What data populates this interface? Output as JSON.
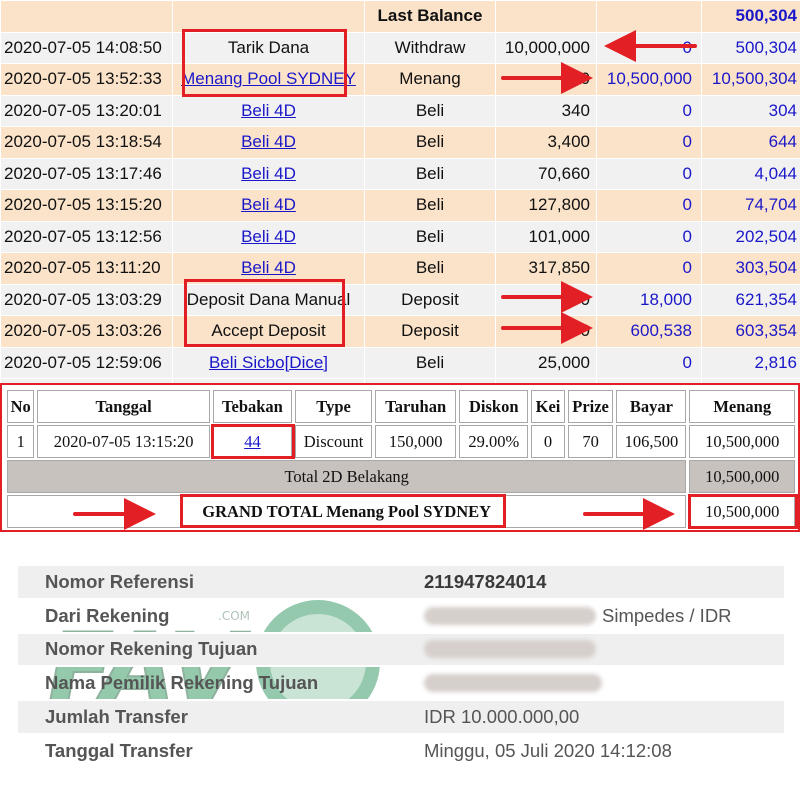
{
  "ledger": {
    "header": {
      "label": "Last Balance",
      "balance": "500,304"
    },
    "rows": [
      {
        "date": "2020-07-05 14:08:50",
        "desc": "Tarik Dana",
        "link": false,
        "type": "Withdraw",
        "debit": "10,000,000",
        "credit": "0",
        "balance": "500,304"
      },
      {
        "date": "2020-07-05 13:52:33",
        "desc": "Menang Pool SYDNEY",
        "link": true,
        "type": "Menang",
        "debit": "0",
        "credit": "10,500,000",
        "balance": "10,500,304"
      },
      {
        "date": "2020-07-05 13:20:01",
        "desc": "Beli 4D",
        "link": true,
        "type": "Beli",
        "debit": "340",
        "credit": "0",
        "balance": "304"
      },
      {
        "date": "2020-07-05 13:18:54",
        "desc": "Beli 4D",
        "link": true,
        "type": "Beli",
        "debit": "3,400",
        "credit": "0",
        "balance": "644"
      },
      {
        "date": "2020-07-05 13:17:46",
        "desc": "Beli 4D",
        "link": true,
        "type": "Beli",
        "debit": "70,660",
        "credit": "0",
        "balance": "4,044"
      },
      {
        "date": "2020-07-05 13:15:20",
        "desc": "Beli 4D",
        "link": true,
        "type": "Beli",
        "debit": "127,800",
        "credit": "0",
        "balance": "74,704"
      },
      {
        "date": "2020-07-05 13:12:56",
        "desc": "Beli 4D",
        "link": true,
        "type": "Beli",
        "debit": "101,000",
        "credit": "0",
        "balance": "202,504"
      },
      {
        "date": "2020-07-05 13:11:20",
        "desc": "Beli 4D",
        "link": true,
        "type": "Beli",
        "debit": "317,850",
        "credit": "0",
        "balance": "303,504"
      },
      {
        "date": "2020-07-05 13:03:29",
        "desc": "Deposit Dana Manual",
        "link": false,
        "type": "Deposit",
        "debit": "0",
        "credit": "18,000",
        "balance": "621,354"
      },
      {
        "date": "2020-07-05 13:03:26",
        "desc": "Accept Deposit",
        "link": false,
        "type": "Deposit",
        "debit": "0",
        "credit": "600,538",
        "balance": "603,354"
      },
      {
        "date": "2020-07-05 12:59:06",
        "desc": "Beli Sicbo[Dice]",
        "link": true,
        "type": "Beli",
        "debit": "25,000",
        "credit": "0",
        "balance": "2,816"
      }
    ]
  },
  "bet": {
    "headers": [
      "No",
      "Tanggal",
      "Tebakan",
      "Type",
      "Taruhan",
      "Diskon",
      "Kei",
      "Prize",
      "Bayar",
      "Menang"
    ],
    "row": {
      "no": "1",
      "tanggal": "2020-07-05 13:15:20",
      "tebakan": "44",
      "type": "Discount",
      "taruhan": "150,000",
      "diskon": "29.00%",
      "kei": "0",
      "prize": "70",
      "bayar": "106,500",
      "menang": "10,500,000"
    },
    "subtotal": {
      "label": "Total 2D Belakang",
      "value": "10,500,000"
    },
    "grand": {
      "label": "GRAND TOTAL  Menang Pool SYDNEY",
      "value": "10,500,000"
    }
  },
  "receipt": {
    "rows": [
      {
        "label": "Nomor Referensi",
        "value": "211947824014",
        "strong": true
      },
      {
        "label": "Dari Rekening",
        "value": "Simpedes / IDR",
        "blurred": true
      },
      {
        "label": "Nomor Rekening Tujuan",
        "value": "",
        "blurred": true
      },
      {
        "label": "Nama Pemilik Rekening Tujuan",
        "value": "",
        "blurred": true
      },
      {
        "label": "Jumlah Transfer",
        "value": "IDR 10.000.000,00"
      },
      {
        "label": "Tanggal Transfer",
        "value": "Minggu, 05 Juli 2020 14:12:08"
      }
    ]
  },
  "watermark": {
    "text": "FAV",
    "small": ".COM"
  },
  "colors": {
    "accent": "#e31f26",
    "link": "#1a17c9",
    "peach": "#fbe3c9",
    "gray": "#f1f1f1",
    "watermark": "#1c8a4e"
  }
}
